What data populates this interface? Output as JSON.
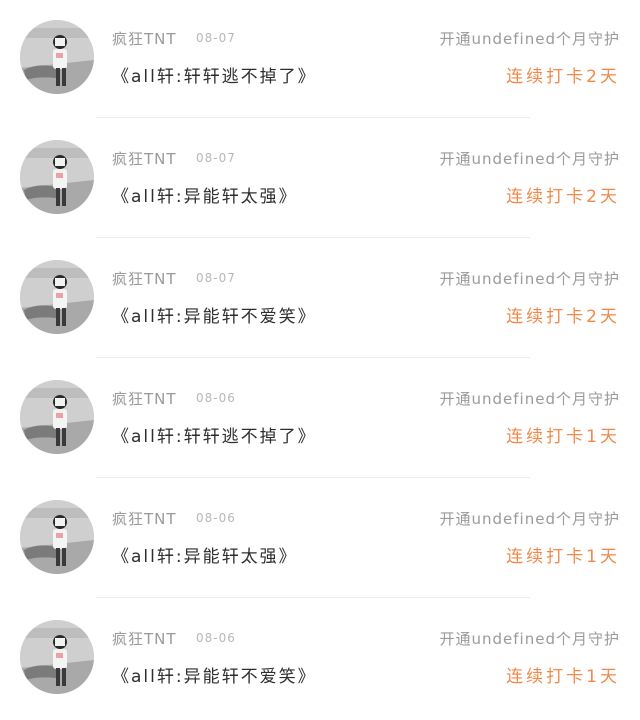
{
  "items": [
    {
      "name": "疯狂TNT",
      "date": "08-07",
      "message": "《all轩:轩轩逃不掉了》",
      "guard": "开通undefined个月守护",
      "streak": "连续打卡2天"
    },
    {
      "name": "疯狂TNT",
      "date": "08-07",
      "message": "《all轩:异能轩太强》",
      "guard": "开通undefined个月守护",
      "streak": "连续打卡2天"
    },
    {
      "name": "疯狂TNT",
      "date": "08-07",
      "message": "《all轩:异能轩不爱笑》",
      "guard": "开通undefined个月守护",
      "streak": "连续打卡2天"
    },
    {
      "name": "疯狂TNT",
      "date": "08-06",
      "message": "《all轩:轩轩逃不掉了》",
      "guard": "开通undefined个月守护",
      "streak": "连续打卡1天"
    },
    {
      "name": "疯狂TNT",
      "date": "08-06",
      "message": "《all轩:异能轩太强》",
      "guard": "开通undefined个月守护",
      "streak": "连续打卡1天"
    },
    {
      "name": "疯狂TNT",
      "date": "08-06",
      "message": "《all轩:异能轩不爱笑》",
      "guard": "开通undefined个月守护",
      "streak": "连续打卡1天"
    }
  ],
  "colors": {
    "streak": "#f0894a",
    "muted": "#9a9a9a",
    "text": "#2e2e2e"
  }
}
